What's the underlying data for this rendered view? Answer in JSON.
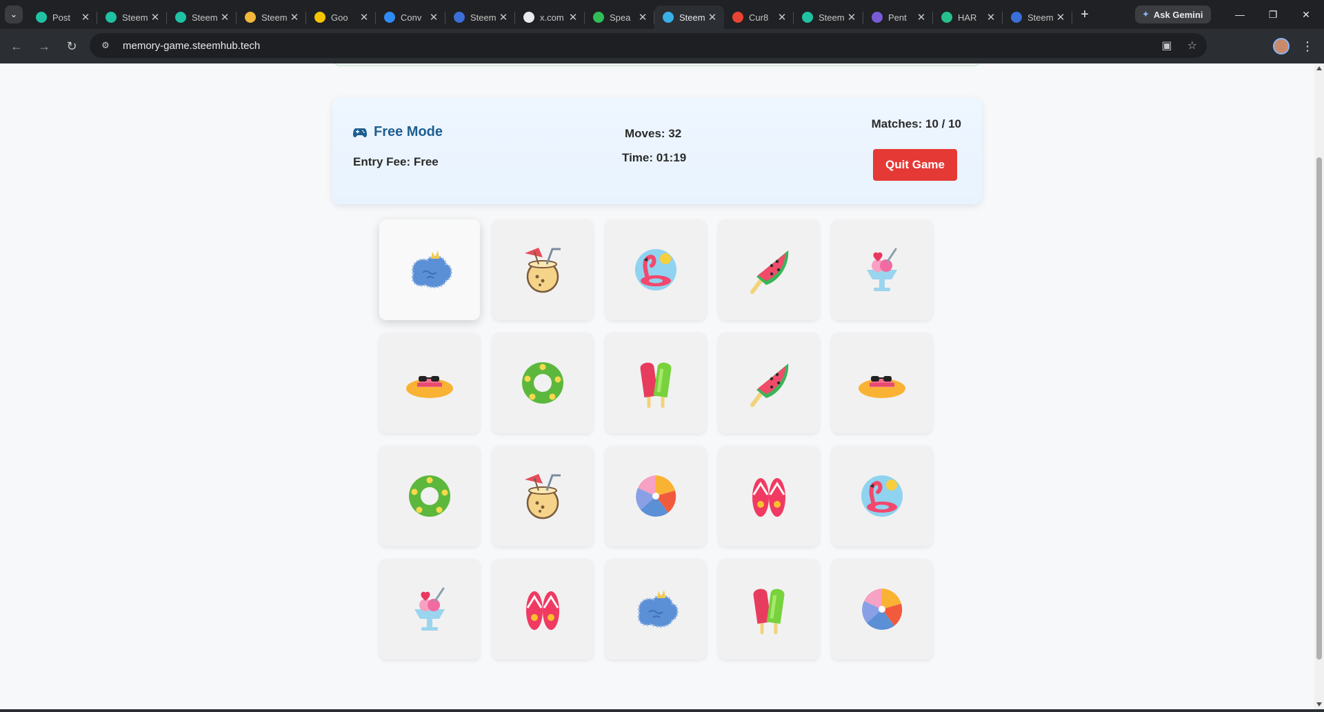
{
  "browser": {
    "tabs": [
      {
        "title": "Post",
        "color": "#1fc2a3",
        "active": false
      },
      {
        "title": "Steem",
        "color": "#1fc2a3",
        "active": false
      },
      {
        "title": "Steem",
        "color": "#1fc2a3",
        "active": false
      },
      {
        "title": "Steem",
        "color": "#f2b73b",
        "active": false
      },
      {
        "title": "Goo",
        "color": "#f6c500",
        "active": false
      },
      {
        "title": "Conv",
        "color": "#2f8cf6",
        "active": false
      },
      {
        "title": "Steem",
        "color": "#3b6fd8",
        "active": false
      },
      {
        "title": "x.com",
        "color": "#e8eaed",
        "active": false
      },
      {
        "title": "Spea",
        "color": "#2fbe57",
        "active": false
      },
      {
        "title": "Steem",
        "color": "#3ab0e8",
        "active": true
      },
      {
        "title": "Cur8",
        "color": "#ea4335",
        "active": false
      },
      {
        "title": "Steem",
        "color": "#1fc2a3",
        "active": false
      },
      {
        "title": "Pent",
        "color": "#7a5bd6",
        "active": false
      },
      {
        "title": "HAR",
        "color": "#27c08c",
        "active": false
      },
      {
        "title": "Steem",
        "color": "#3b6fd8",
        "active": false
      }
    ],
    "ask_gemini": "Ask Gemini",
    "url": "memory-game.steemhub.tech"
  },
  "game": {
    "mode": "Free Mode",
    "entry_fee": "Entry Fee: Free",
    "moves": "Moves: 32",
    "time": "Time: 01:19",
    "matches": "Matches: 10 / 10",
    "quit_label": "Quit Game",
    "accent_color": "#1d5e91",
    "quit_color": "#e53935",
    "cards": [
      {
        "icon": "pool-splash-icon",
        "selected": true
      },
      {
        "icon": "coconut-drink-icon",
        "selected": false
      },
      {
        "icon": "flamingo-float-icon",
        "selected": false
      },
      {
        "icon": "watermelon-popsicle-icon",
        "selected": false
      },
      {
        "icon": "ice-cream-sundae-icon",
        "selected": false
      },
      {
        "icon": "sun-hat-icon",
        "selected": false
      },
      {
        "icon": "swim-ring-icon",
        "selected": false
      },
      {
        "icon": "popsicles-icon",
        "selected": false
      },
      {
        "icon": "watermelon-popsicle-icon",
        "selected": false
      },
      {
        "icon": "sun-hat-icon",
        "selected": false
      },
      {
        "icon": "swim-ring-icon",
        "selected": false
      },
      {
        "icon": "coconut-drink-icon",
        "selected": false
      },
      {
        "icon": "beach-ball-icon",
        "selected": false
      },
      {
        "icon": "flip-flops-icon",
        "selected": false
      },
      {
        "icon": "flamingo-float-icon",
        "selected": false
      },
      {
        "icon": "ice-cream-sundae-icon",
        "selected": false
      },
      {
        "icon": "flip-flops-icon",
        "selected": false
      },
      {
        "icon": "pool-splash-icon",
        "selected": false
      },
      {
        "icon": "popsicles-icon",
        "selected": false
      },
      {
        "icon": "beach-ball-icon",
        "selected": false
      }
    ]
  }
}
